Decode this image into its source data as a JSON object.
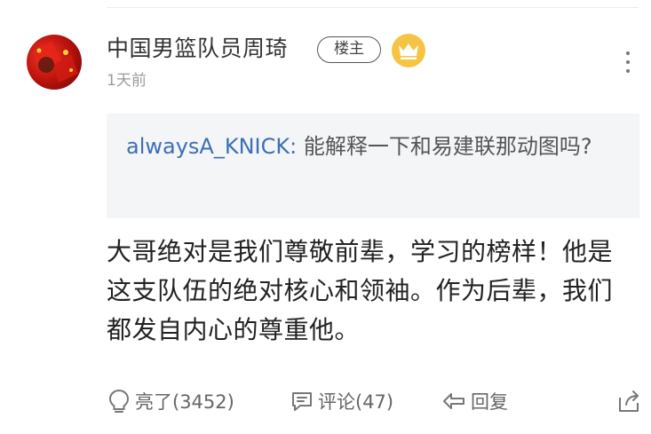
{
  "post": {
    "author": "中国男篮队员周琦",
    "op_badge": "楼主",
    "badge_icon": "crown-icon",
    "time": "1天前",
    "quote": {
      "author": "alwaysA_KNICK:",
      "text": "能解释一下和易建联那动图吗?"
    },
    "content": "大哥绝对是我们尊敬前辈，学习的榜样！他是这支队伍的绝对核心和领袖。作为后辈，我们都发自内心的尊重他。"
  },
  "actions": {
    "like_label": "亮了(3452)",
    "comment_label": "评论(47)",
    "reply_label": "回复"
  },
  "colors": {
    "link_blue": "#3d6fb6",
    "badge_gold": "#f6c443",
    "quote_bg": "#f4f5f7",
    "muted_gray": "#9a9a9a"
  }
}
